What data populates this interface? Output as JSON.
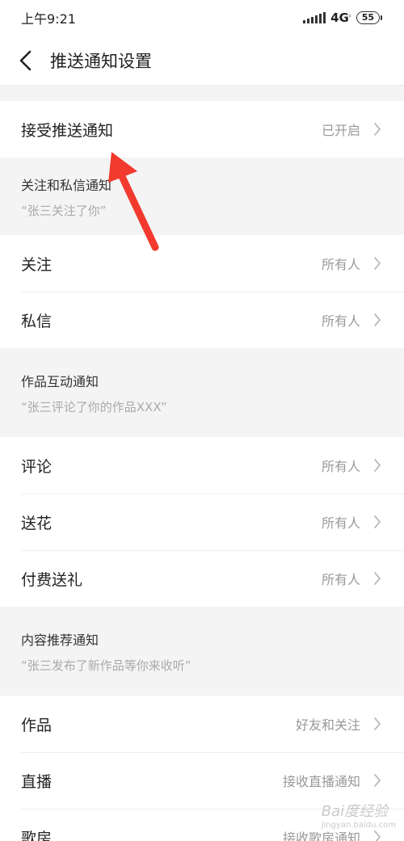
{
  "status_bar": {
    "time": "上午9:21",
    "network": "4G",
    "battery": "55"
  },
  "nav": {
    "title": "推送通知设置"
  },
  "main_toggle": {
    "label": "接受推送通知",
    "value": "已开启"
  },
  "sections": [
    {
      "title": "关注和私信通知",
      "desc": "“张三关注了你”",
      "items": [
        {
          "label": "关注",
          "value": "所有人"
        },
        {
          "label": "私信",
          "value": "所有人"
        }
      ]
    },
    {
      "title": "作品互动通知",
      "desc": "“张三评论了你的作品XXX”",
      "items": [
        {
          "label": "评论",
          "value": "所有人"
        },
        {
          "label": "送花",
          "value": "所有人"
        },
        {
          "label": "付费送礼",
          "value": "所有人"
        }
      ]
    },
    {
      "title": "内容推荐通知",
      "desc": "“张三发布了新作品等你来收听”",
      "items": [
        {
          "label": "作品",
          "value": "好友和关注"
        },
        {
          "label": "直播",
          "value": "接收直播通知"
        },
        {
          "label": "歌房",
          "value": "接收歌房通知"
        }
      ]
    }
  ],
  "watermark": {
    "text": "Bai度经验",
    "sub": "jingyan.baidu.com"
  },
  "colors": {
    "annotation_arrow": "#f23a2e",
    "section_bg": "#f4f4f4",
    "value_text": "#999999"
  },
  "icons": {
    "back": "chevron-left-icon",
    "row": "chevron-right-icon",
    "signal": "signal-icon"
  }
}
